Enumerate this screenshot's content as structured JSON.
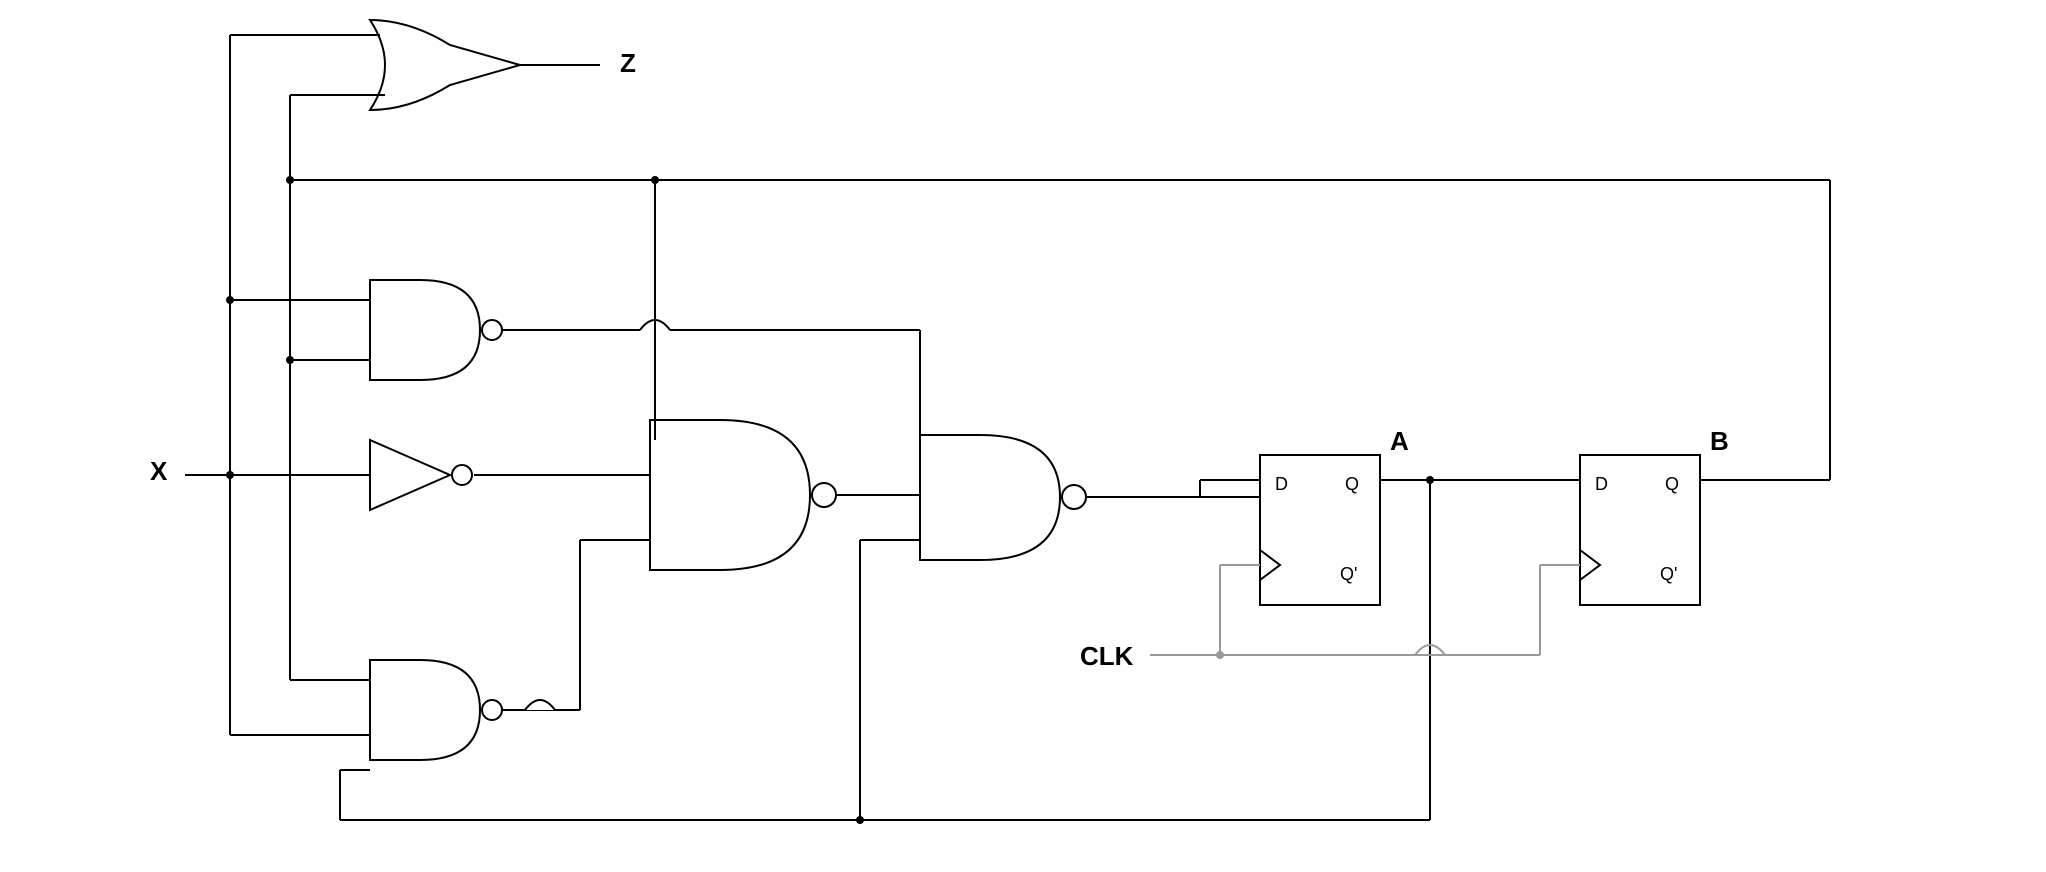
{
  "labels": {
    "input_x": "X",
    "output_z": "Z",
    "clock": "CLK",
    "ff_a": "A",
    "ff_b": "B",
    "ff_d": "D",
    "ff_q": "Q",
    "ff_qn": "Q'"
  },
  "gates": [
    {
      "id": "or1",
      "type": "OR",
      "output_label": "Z"
    },
    {
      "id": "nand1",
      "type": "NAND"
    },
    {
      "id": "not1",
      "type": "NOT"
    },
    {
      "id": "nand2",
      "type": "NAND"
    },
    {
      "id": "nand3",
      "type": "NAND-3in"
    },
    {
      "id": "nand4",
      "type": "NAND"
    }
  ],
  "flipflops": [
    {
      "id": "ffA",
      "type": "D",
      "output_label": "A"
    },
    {
      "id": "ffB",
      "type": "D",
      "output_label": "B"
    }
  ],
  "inputs": [
    "X",
    "CLK"
  ],
  "outputs": [
    "Z",
    "A",
    "B"
  ]
}
